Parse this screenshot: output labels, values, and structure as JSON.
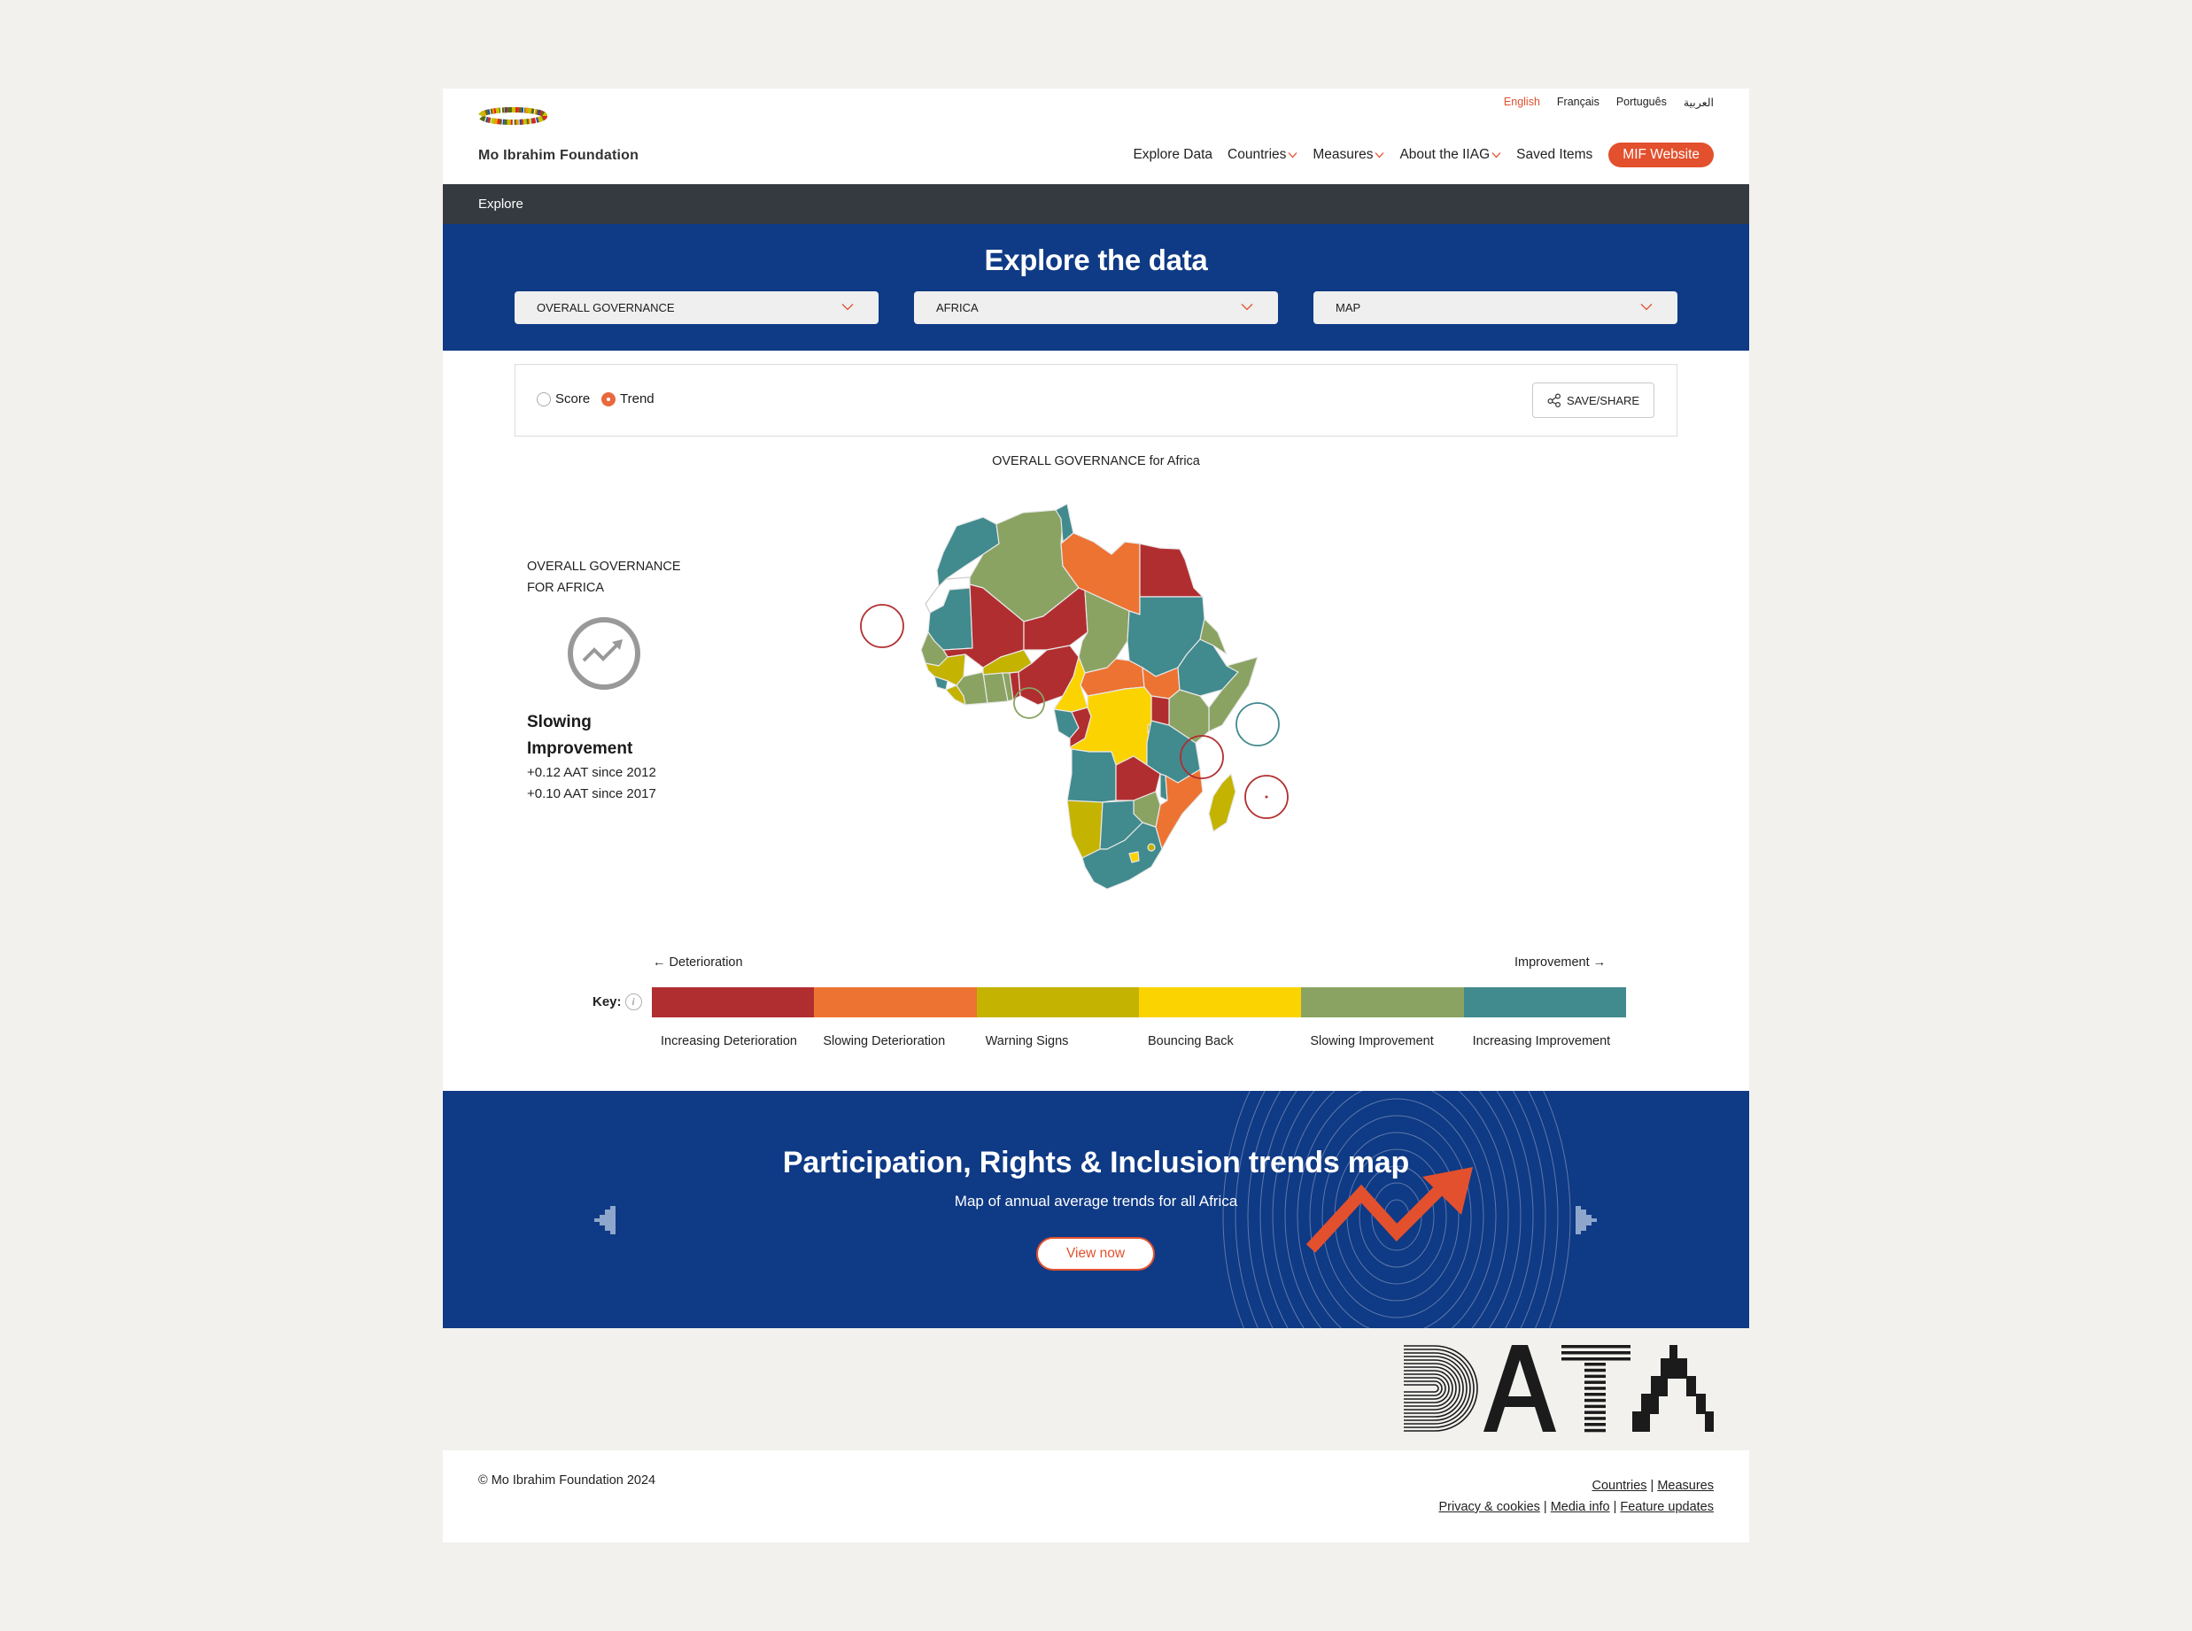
{
  "header": {
    "brand": "Mo Ibrahim Foundation",
    "languages": [
      {
        "label": "English",
        "active": true
      },
      {
        "label": "Français",
        "active": false
      },
      {
        "label": "Português",
        "active": false
      },
      {
        "label": "العربية",
        "active": false
      }
    ],
    "nav": [
      {
        "label": "Explore Data",
        "dropdown": false
      },
      {
        "label": "Countries",
        "dropdown": true
      },
      {
        "label": "Measures",
        "dropdown": true
      },
      {
        "label": "About the IIAG",
        "dropdown": true
      },
      {
        "label": "Saved Items",
        "dropdown": false
      }
    ],
    "cta": "MIF Website"
  },
  "breadcrumb": "Explore",
  "explore": {
    "title": "Explore the data",
    "selects": [
      {
        "value": "OVERALL GOVERNANCE"
      },
      {
        "value": "AFRICA"
      },
      {
        "value": "MAP"
      }
    ]
  },
  "controls": {
    "radios": [
      {
        "label": "Score",
        "checked": false
      },
      {
        "label": "Trend",
        "checked": true
      }
    ],
    "save_share": "SAVE/SHARE"
  },
  "map": {
    "title": "OVERALL GOVERNANCE for Africa",
    "summary": {
      "label_line1": "OVERALL GOVERNANCE",
      "label_line2": "FOR AFRICA",
      "icon": "trend-up-icon",
      "status_line1": "Slowing",
      "status_line2": "Improvement",
      "stat1": "+0.12 AAT since 2012",
      "stat2": "+0.10 AAT since 2017"
    }
  },
  "key": {
    "label": "Key:",
    "left": "Deterioration",
    "right": "Improvement",
    "categories": [
      {
        "label": "Increasing Deterioration",
        "color": "#b12e30"
      },
      {
        "label": "Slowing Deterioration",
        "color": "#ed7332"
      },
      {
        "label": "Warning Signs",
        "color": "#c4b300"
      },
      {
        "label": "Bouncing Back",
        "color": "#fbd300"
      },
      {
        "label": "Slowing Improvement",
        "color": "#8aa362"
      },
      {
        "label": "Increasing Improvement",
        "color": "#418a8e"
      }
    ]
  },
  "banner": {
    "title": "Participation, Rights & Inclusion trends map",
    "subtitle": "Map of annual average trends for all Africa",
    "button": "View now"
  },
  "data_logo": "DATA",
  "footer": {
    "copyright": "© Mo Ibrahim Foundation 2024",
    "links_row1": [
      "Countries",
      "Measures"
    ],
    "links_row2": [
      "Privacy & cookies",
      "Media info",
      "Feature updates"
    ]
  },
  "colors": {
    "accent": "#e3502d",
    "navy": "#0f3a85",
    "dark_bar": "#353a40"
  }
}
